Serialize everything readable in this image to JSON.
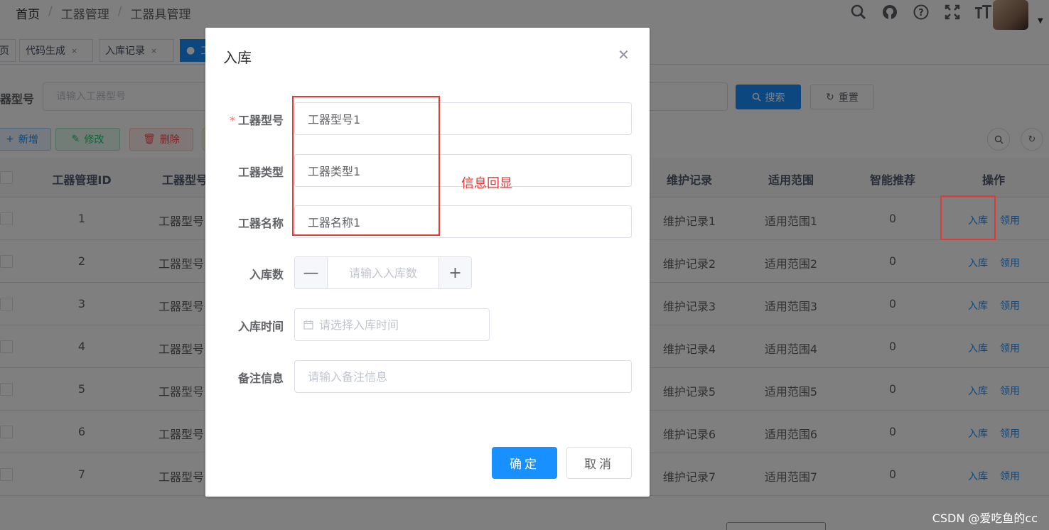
{
  "navbar": {
    "breadcrumb": [
      "首页",
      "工器管理",
      "工器具管理"
    ],
    "icons": [
      "search-icon",
      "github-icon",
      "question-icon",
      "fullscreen-icon",
      "font-size-icon"
    ]
  },
  "tags": [
    {
      "label": "页",
      "closable": false
    },
    {
      "label": "代码生成",
      "closable": true
    },
    {
      "label": "入库记录",
      "closable": true
    },
    {
      "label": "工",
      "active": true
    }
  ],
  "search": {
    "model_label": "器型号",
    "model_placeholder": "请输入工器型号",
    "search_button": "搜索",
    "reset_button": "重置"
  },
  "toolbar": {
    "add": "新增",
    "edit": "修改",
    "delete": "删除"
  },
  "table": {
    "headers": [
      "工器管理ID",
      "工器型号",
      "维护记录",
      "适用范围",
      "智能推荐",
      "操作"
    ],
    "rows": [
      {
        "id": "1",
        "model": "工器型号",
        "maint": "维护记录1",
        "scope": "适用范围1",
        "rec": "0"
      },
      {
        "id": "2",
        "model": "工器型号",
        "maint": "维护记录2",
        "scope": "适用范围2",
        "rec": "0"
      },
      {
        "id": "3",
        "model": "工器型号",
        "maint": "维护记录3",
        "scope": "适用范围3",
        "rec": "0"
      },
      {
        "id": "4",
        "model": "工器型号",
        "maint": "维护记录4",
        "scope": "适用范围4",
        "rec": "0"
      },
      {
        "id": "5",
        "model": "工器型号",
        "maint": "维护记录5",
        "scope": "适用范围5",
        "rec": "0"
      },
      {
        "id": "6",
        "model": "工器型号",
        "maint": "维护记录6",
        "scope": "适用范围6",
        "rec": "0"
      },
      {
        "id": "7",
        "model": "工器型号",
        "maint": "维护记录7",
        "scope": "适用范围7",
        "rec": "0"
      }
    ],
    "action_in": "入库",
    "action_use": "领用"
  },
  "dialog": {
    "title": "入库",
    "fields": {
      "model_label": "工器型号",
      "model_value": "工器型号1",
      "type_label": "工器类型",
      "type_value": "工器类型1",
      "name_label": "工器名称",
      "name_value": "工器名称1",
      "qty_label": "入库数",
      "qty_placeholder": "请输入入库数",
      "time_label": "入库时间",
      "time_placeholder": "请选择入库时间",
      "remark_label": "备注信息",
      "remark_placeholder": "请输入备注信息"
    },
    "confirm": "确定",
    "cancel": "取消"
  },
  "annotation": {
    "text": "信息回显",
    "color": "#e53935"
  },
  "watermark": "CSDN @爱吃鱼的cc",
  "colors": {
    "primary": "#1890ff",
    "required": "#f56c6c",
    "annotation": "#e53935"
  }
}
